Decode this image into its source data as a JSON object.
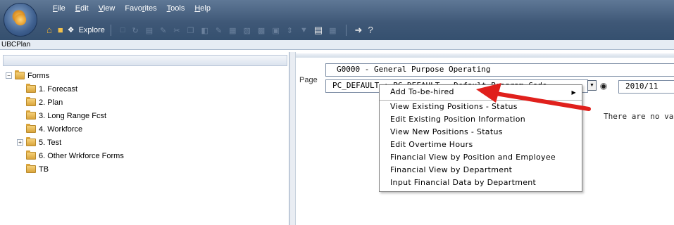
{
  "app": {
    "menu": [
      "File",
      "Edit",
      "View",
      "Favorites",
      "Tools",
      "Help"
    ],
    "menu_underline": [
      "F",
      "E",
      "V",
      "r",
      "T",
      "H"
    ],
    "toolbar_explore": "Explore",
    "window_title": "UBCPlan"
  },
  "tree": {
    "root": "Forms",
    "root_toggle": "−",
    "items": [
      {
        "label": "1. Forecast",
        "toggle": ""
      },
      {
        "label": "2. Plan",
        "toggle": ""
      },
      {
        "label": "3. Long Range Fcst",
        "toggle": ""
      },
      {
        "label": "4. Workforce",
        "toggle": ""
      },
      {
        "label": "5. Test",
        "toggle": "+"
      },
      {
        "label": "6. Other Wrkforce Forms",
        "toggle": ""
      },
      {
        "label": "TB",
        "toggle": ""
      }
    ]
  },
  "main": {
    "page_label": "Page",
    "entity_value": "G0000 - General Purpose Operating",
    "scenario_value": "PC_DEFAULT : PC_DEFAULT - Default Program Code",
    "year_value": "2010/11",
    "empty_message": "There are no values"
  },
  "context_menu": {
    "items": [
      "Add To-be-hired",
      "View Existing Positions - Status",
      "Edit Existing Position Information",
      "View New Positions - Status",
      "Edit Overtime Hours",
      "Financial View by Position and Employee",
      "Financial View by Department",
      "Input Financial Data by Department"
    ]
  },
  "colors": {
    "header_blue": "#3f5877",
    "arrow_red": "#e0201c"
  }
}
